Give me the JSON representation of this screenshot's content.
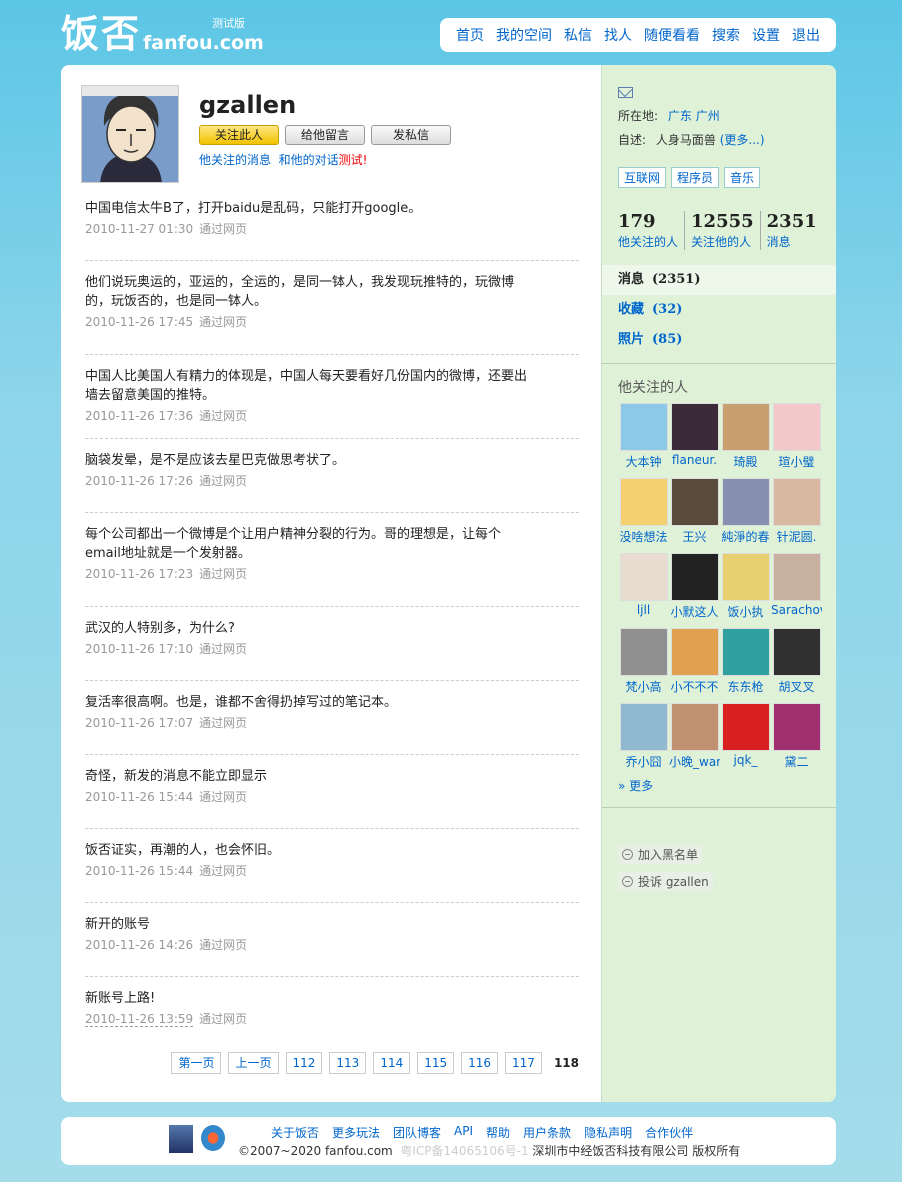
{
  "logo": {
    "cn": "饭否",
    "en": "fanfou.com",
    "beta": "测试版"
  },
  "nav": [
    "首页",
    "我的空间",
    "私信",
    "找人",
    "随便看看",
    "搜索",
    "设置",
    "退出"
  ],
  "profile": {
    "name": "gzallen",
    "buttons": {
      "follow": "关注此人",
      "message": "给他留言",
      "dm": "发私信"
    },
    "links": {
      "his_follow": "他关注的消息",
      "dialog": "和他的对话",
      "test": "测试!"
    }
  },
  "statuses": [
    {
      "text": "中国电信太牛B了，打开baidu是乱码，只能打开google。",
      "time": "2010-11-27 01:30",
      "via": "通过网页"
    },
    {
      "text": "他们说玩奥运的，亚运的，全运的，是同一钵人，我发现玩推特的，玩微博的，玩饭否的，也是同一钵人。",
      "time": "2010-11-26 17:45",
      "via": "通过网页"
    },
    {
      "text": "中国人比美国人有精力的体现是，中国人每天要看好几份国内的微博，还要出墙去留意美国的推特。",
      "time": "2010-11-26 17:36",
      "via": "通过网页"
    },
    {
      "text": "脑袋发晕，是不是应该去星巴克做思考状了。",
      "time": "2010-11-26 17:26",
      "via": "通过网页"
    },
    {
      "text": "每个公司都出一个微博是个让用户精神分裂的行为。哥的理想是，让每个email地址就是一个发射器。",
      "time": "2010-11-26 17:23",
      "via": "通过网页"
    },
    {
      "text": "武汉的人特别多，为什么?",
      "time": "2010-11-26 17:10",
      "via": "通过网页"
    },
    {
      "text": "复活率很高啊。也是，谁都不舍得扔掉写过的笔记本。",
      "time": "2010-11-26 17:07",
      "via": "通过网页"
    },
    {
      "text": "奇怪，新发的消息不能立即显示",
      "time": "2010-11-26 15:44",
      "via": "通过网页"
    },
    {
      "text": "饭否证实，再潮的人，也会怀旧。",
      "time": "2010-11-26 15:44",
      "via": "通过网页"
    },
    {
      "text": "新开的账号",
      "time": "2010-11-26 14:26",
      "via": "通过网页"
    },
    {
      "text": "新账号上路!",
      "time": "2010-11-26 13:59",
      "via": "通过网页"
    }
  ],
  "pager": {
    "first": "第一页",
    "prev": "上一页",
    "pages": [
      "112",
      "113",
      "114",
      "115",
      "116",
      "117"
    ],
    "current": "118"
  },
  "sidebar": {
    "location_label": "所在地:",
    "location": "广东 广州",
    "bio_label": "自述:",
    "bio": "人身马面兽",
    "bio_more": "(更多...)",
    "tags": [
      "互联网",
      "程序员",
      "音乐"
    ],
    "stats": [
      {
        "num": "179",
        "label": "他关注的人"
      },
      {
        "num": "12555",
        "label": "关注他的人"
      },
      {
        "num": "2351",
        "label": "消息"
      }
    ],
    "menu": [
      {
        "label": "消息",
        "count": "(2351)"
      },
      {
        "label": "收藏",
        "count": "(32)"
      },
      {
        "label": "照片",
        "count": "(85)"
      }
    ],
    "following_title": "他关注的人",
    "following": [
      {
        "name": "大本钟",
        "color": "#8cc8e8"
      },
      {
        "name": "flaneur.",
        "color": "#3a2a3a"
      },
      {
        "name": "琦殿",
        "color": "#c8a070"
      },
      {
        "name": "瑄小璧",
        "color": "#f2c8c8"
      },
      {
        "name": "没啥想法",
        "color": "#f5d070"
      },
      {
        "name": "王兴",
        "color": "#5a4a3a"
      },
      {
        "name": "純淨的春",
        "color": "#8890b0"
      },
      {
        "name": "针泥圆.",
        "color": "#d8b8a0"
      },
      {
        "name": "ljll",
        "color": "#e8dcd0"
      },
      {
        "name": "小默这人",
        "color": "#222222"
      },
      {
        "name": "饭小执",
        "color": "#e8d070"
      },
      {
        "name": "Sarachov",
        "color": "#c8b0a0"
      },
      {
        "name": "梵小高",
        "color": "#909090"
      },
      {
        "name": "小不不不",
        "color": "#e0a050"
      },
      {
        "name": "东东枪",
        "color": "#30a0a0"
      },
      {
        "name": "胡叉叉",
        "color": "#303030"
      },
      {
        "name": "乔小囧",
        "color": "#90b8d0"
      },
      {
        "name": "小晚_war",
        "color": "#c09070"
      },
      {
        "name": "jqk_",
        "color": "#d82020"
      },
      {
        "name": "黛二",
        "color": "#a03070"
      }
    ],
    "more": "» 更多",
    "actions": [
      "加入黑名单",
      "投诉 gzallen"
    ]
  },
  "footer": {
    "links": [
      "关于饭否",
      "更多玩法",
      "团队博客",
      "API",
      "帮助",
      "用户条款",
      "隐私声明",
      "合作伙伴"
    ],
    "copyright": "©2007~2020 fanfou.com",
    "icp": "粤ICP备14065106号-1",
    "company": "深圳市中经饭否科技有限公司 版权所有"
  }
}
